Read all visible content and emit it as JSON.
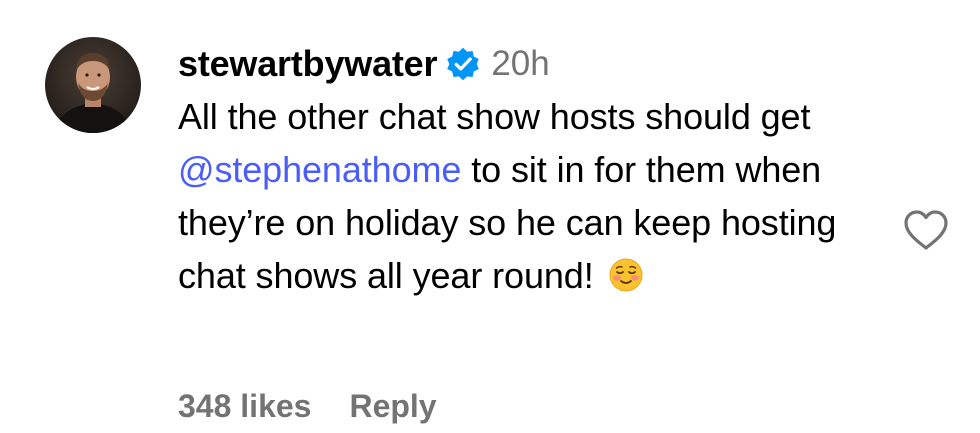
{
  "comment": {
    "username": "stewartbywater",
    "verified": true,
    "timestamp": "20h",
    "text_before_mention": "All the other chat show hosts should get ",
    "mention": "@stephenathome",
    "text_after_mention": " to sit in for them when they’re on holiday so he can keep hosting chat shows all year round! ",
    "emoji": "smiling-face-emoji",
    "likes": "348 likes",
    "reply_label": "Reply"
  },
  "icons": {
    "verified": "verified-badge-icon",
    "like": "heart-outline-icon"
  },
  "colors": {
    "mention": "#4a5df9",
    "verified": "#0095f6",
    "secondary_text": "#737373"
  }
}
